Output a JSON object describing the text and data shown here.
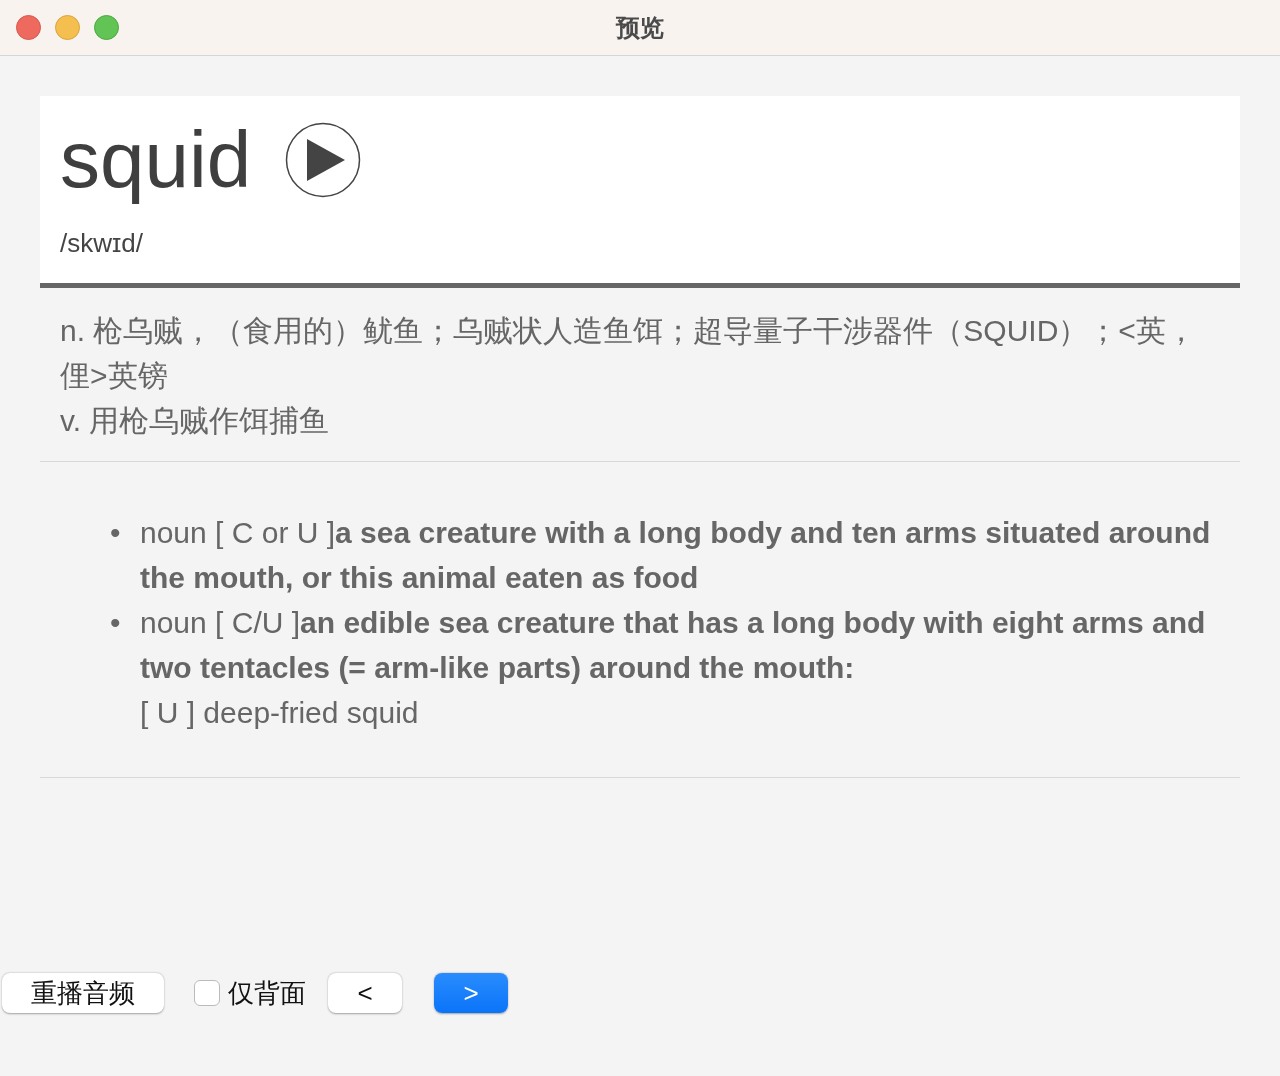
{
  "window": {
    "title": "预览"
  },
  "entry": {
    "word": "squid",
    "phonetic": "/skwɪd/"
  },
  "meanings": [
    "n. 枪乌贼，（食用的）鱿鱼；乌贼状人造鱼饵；超导量子干涉器件（SQUID）；<英，俚>英镑",
    "v. 用枪乌贼作饵捕鱼"
  ],
  "definitions": [
    {
      "bullet": "•",
      "text": "noun [ C or U ]**a sea creature with a long body and ten arms situated around the mouth, or this animal eaten as food**"
    },
    {
      "bullet": "•",
      "text": "noun [ C/U ]**an edible sea creature that has a long body with eight arms and two tentacles (= arm-like parts) around the mouth:**",
      "example": "[ U ] deep-fried squid"
    }
  ],
  "footer": {
    "replay_button": "重播音频",
    "back_only": {
      "label": "仅背面",
      "checked": false
    },
    "nav_buttons": [
      {
        "label": "<",
        "kind": "default"
      },
      {
        "label": ">",
        "kind": "primary"
      }
    ]
  }
}
